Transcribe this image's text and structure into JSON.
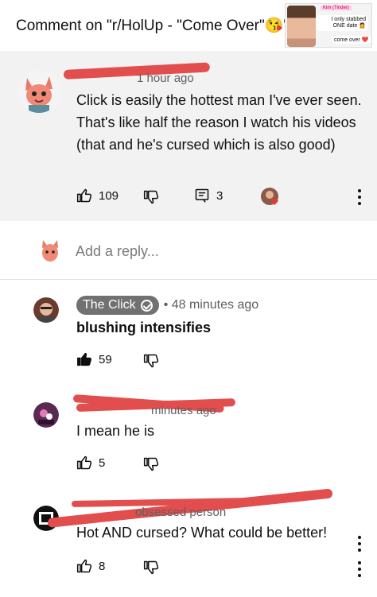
{
  "header": {
    "title": "Comment on \"r/HolUp - \"Come Over\"😘\"",
    "thumbnail": {
      "name_tag": "Kim (Tinder)",
      "message1": "I only stabbed ONE date 🙍",
      "message2": "come over ❤️"
    }
  },
  "main_comment": {
    "meta": "1 hour ago",
    "text": "Click is easily the hottest man I've ever seen. That's like half the reason I watch his videos (that and he's cursed which is also good)",
    "likes": "109",
    "replies": "3"
  },
  "reply_box": {
    "placeholder": "Add a reply..."
  },
  "replies": [
    {
      "author": "The Click",
      "meta": "• 48 minutes ago",
      "text": "blushing intensifies",
      "likes": "59",
      "liked": true
    },
    {
      "meta": "minutes ago",
      "text": "I mean he is",
      "likes": "5",
      "liked": false
    },
    {
      "meta": "obsessed person",
      "text": "Hot AND cursed? What could be better!",
      "likes": "8",
      "liked": false
    }
  ],
  "colors": {
    "redaction": "#e24d4d",
    "accent_red": "#e53935",
    "chip_bg": "#717171"
  }
}
